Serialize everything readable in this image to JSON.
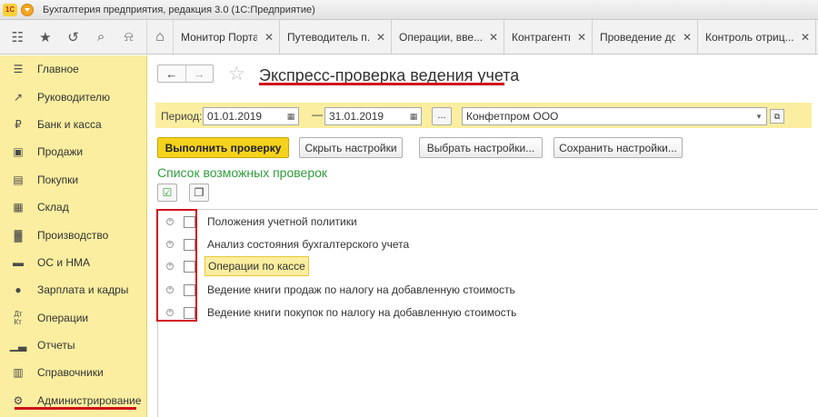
{
  "window": {
    "logo_text": "1С",
    "title": "Бухгалтерия предприятия, редакция 3.0  (1С:Предприятие)"
  },
  "toolbar": {
    "icons": [
      "apps-grid-icon",
      "star-icon",
      "history-icon",
      "search-icon",
      "bell-icon",
      "home-icon"
    ]
  },
  "tabs": [
    {
      "label": "Монитор Порта..."
    },
    {
      "label": "Путеводитель п..."
    },
    {
      "label": "Операции, вве..."
    },
    {
      "label": "Контрагенты"
    },
    {
      "label": "Проведение до..."
    },
    {
      "label": "Контроль отриц..."
    }
  ],
  "sidebar": {
    "items": [
      {
        "label": "Главное",
        "icon": "menu-lines-icon"
      },
      {
        "label": "Руководителю",
        "icon": "chart-up-icon"
      },
      {
        "label": "Банк и касса",
        "icon": "ruble-coin-icon"
      },
      {
        "label": "Продажи",
        "icon": "shopping-bag-icon"
      },
      {
        "label": "Покупки",
        "icon": "cart-icon"
      },
      {
        "label": "Склад",
        "icon": "warehouse-grid-icon"
      },
      {
        "label": "Производство",
        "icon": "factory-icon"
      },
      {
        "label": "ОС и НМА",
        "icon": "car-icon"
      },
      {
        "label": "Зарплата и кадры",
        "icon": "person-icon"
      },
      {
        "label": "Операции",
        "icon": "dt-kt-icon"
      },
      {
        "label": "Отчеты",
        "icon": "bar-chart-icon"
      },
      {
        "label": "Справочники",
        "icon": "books-icon"
      },
      {
        "label": "Администрирование",
        "icon": "gear-icon"
      }
    ]
  },
  "page": {
    "title": "Экспресс-проверка ведения учета",
    "period_label": "Период:",
    "date_from": "01.01.2019",
    "date_to": "31.01.2019",
    "dash": "—",
    "dots": "...",
    "organization": "Конфетпром ООО"
  },
  "buttons": {
    "run": "Выполнить проверку",
    "hide_settings": "Скрыть настройки",
    "choose_settings": "Выбрать настройки...",
    "save_settings": "Сохранить настройки..."
  },
  "checks": {
    "section_title": "Список возможных проверок",
    "items": [
      {
        "label": "Положения учетной политики",
        "checked": false
      },
      {
        "label": "Анализ состояния бухгалтерского учета",
        "checked": false
      },
      {
        "label": "Операции по кассе",
        "checked": false,
        "selected": true
      },
      {
        "label": "Ведение книги продаж по налогу на добавленную стоимость",
        "checked": false
      },
      {
        "label": "Ведение книги покупок по налогу на добавленную стоимость",
        "checked": false
      }
    ]
  },
  "colors": {
    "accent_yellow": "#fbeea0",
    "primary_button": "#f5d21c",
    "highlight_red": "#d1111b",
    "section_green": "#2e9e3b"
  }
}
